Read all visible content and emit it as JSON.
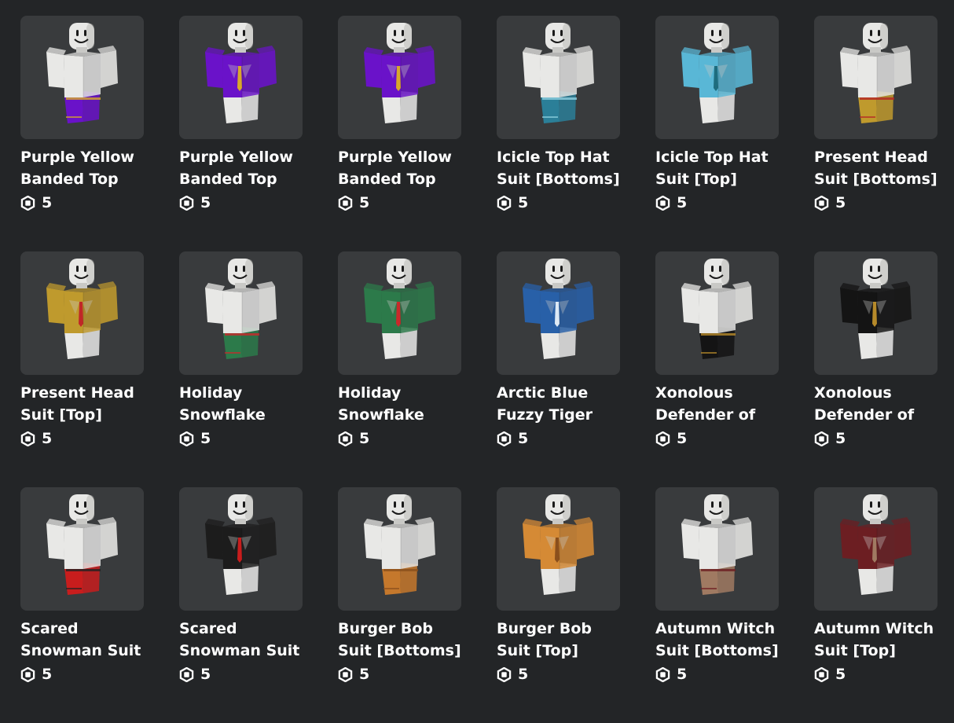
{
  "currency_icon": "robux-icon",
  "items": [
    {
      "name": "Purple Yellow Banded Top",
      "price": "5",
      "type": "pants",
      "colors": {
        "shirt": "#e8e8e6",
        "pants": "#6a12c9",
        "accent": "#d7a82a"
      }
    },
    {
      "name": "Purple Yellow Banded Top",
      "price": "5",
      "type": "shirt",
      "colors": {
        "shirt": "#6a12c9",
        "pants": "#e8e8e6",
        "accent": "#d7a82a"
      }
    },
    {
      "name": "Purple Yellow Banded Top",
      "price": "5",
      "type": "shirt",
      "colors": {
        "shirt": "#6a12c9",
        "pants": "#e8e8e6",
        "accent": "#d7a82a"
      }
    },
    {
      "name": "Icicle Top Hat Suit [Bottoms]",
      "price": "5",
      "type": "pants",
      "colors": {
        "shirt": "#e8e8e6",
        "pants": "#2b7f98",
        "accent": "#8fd0e0"
      }
    },
    {
      "name": "Icicle Top Hat Suit [Top]",
      "price": "5",
      "type": "shirt",
      "colors": {
        "shirt": "#59b7d6",
        "pants": "#e8e8e6",
        "accent": "#1e6c7e"
      }
    },
    {
      "name": "Present Head Suit [Bottoms]",
      "price": "5",
      "type": "pants",
      "colors": {
        "shirt": "#e8e8e6",
        "pants": "#bf9a2d",
        "accent": "#b52525"
      }
    },
    {
      "name": "Present Head Suit [Top]",
      "price": "5",
      "type": "shirt",
      "colors": {
        "shirt": "#bf9a2d",
        "pants": "#e8e8e6",
        "accent": "#c02727"
      }
    },
    {
      "name": "Holiday Snowflake",
      "price": "5",
      "type": "pants",
      "colors": {
        "shirt": "#e8e8e6",
        "pants": "#2c7a4a",
        "accent": "#c8292b"
      }
    },
    {
      "name": "Holiday Snowflake",
      "price": "5",
      "type": "shirt",
      "colors": {
        "shirt": "#2c7a4a",
        "pants": "#e8e8e6",
        "accent": "#c8292b"
      }
    },
    {
      "name": "Arctic Blue Fuzzy Tiger",
      "price": "5",
      "type": "shirt",
      "colors": {
        "shirt": "#2860a8",
        "pants": "#e8e8e6",
        "accent": "#dde9f5"
      }
    },
    {
      "name": "Xonolous Defender of",
      "price": "5",
      "type": "pants",
      "colors": {
        "shirt": "#e8e8e6",
        "pants": "#141414",
        "accent": "#b68a2a"
      }
    },
    {
      "name": "Xonolous Defender of",
      "price": "5",
      "type": "shirt",
      "colors": {
        "shirt": "#141414",
        "pants": "#e8e8e6",
        "accent": "#b68a2a"
      }
    },
    {
      "name": "Scared Snowman Suit",
      "price": "5",
      "type": "pants",
      "colors": {
        "shirt": "#e8e8e6",
        "pants": "#c81d1d",
        "accent": "#222222"
      }
    },
    {
      "name": "Scared Snowman Suit",
      "price": "5",
      "type": "shirt",
      "colors": {
        "shirt": "#1c1c1c",
        "pants": "#e8e8e6",
        "accent": "#c81d1d"
      }
    },
    {
      "name": "Burger Bob Suit [Bottoms]",
      "price": "5",
      "type": "pants",
      "colors": {
        "shirt": "#e8e8e6",
        "pants": "#c5782c",
        "accent": "#8a4f1c"
      }
    },
    {
      "name": "Burger Bob Suit [Top]",
      "price": "5",
      "type": "shirt",
      "colors": {
        "shirt": "#d58a35",
        "pants": "#e8e8e6",
        "accent": "#8a4f1c"
      }
    },
    {
      "name": "Autumn Witch Suit [Bottoms]",
      "price": "5",
      "type": "pants",
      "colors": {
        "shirt": "#e8e8e6",
        "pants": "#a07a62",
        "accent": "#6c1e22"
      }
    },
    {
      "name": "Autumn Witch Suit [Top]",
      "price": "5",
      "type": "shirt",
      "colors": {
        "shirt": "#6c1e22",
        "pants": "#e8e8e6",
        "accent": "#a07a62"
      }
    }
  ]
}
